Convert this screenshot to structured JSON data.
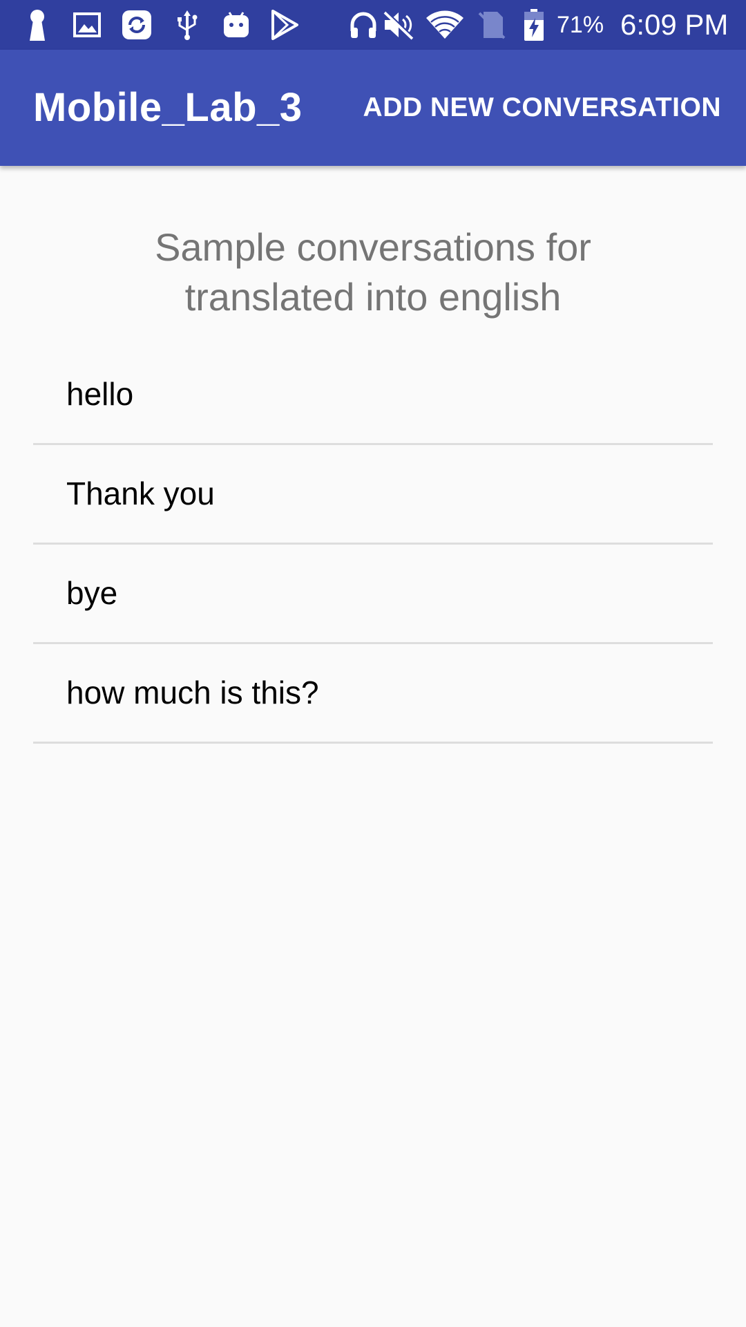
{
  "status_bar": {
    "battery_percent": "71%",
    "time": "6:09 PM",
    "icons": [
      "keyhole-icon",
      "image-icon",
      "sync-icon",
      "usb-icon",
      "android-icon",
      "play-store-icon",
      "headphones-icon",
      "mute-icon",
      "wifi-icon",
      "no-sim-icon",
      "battery-charging-icon"
    ]
  },
  "app_bar": {
    "title": "Mobile_Lab_3",
    "action_label": "ADD NEW CONVERSATION"
  },
  "main": {
    "heading_line1": "Sample conversations for",
    "heading_line2": "translated into english",
    "conversations": [
      {
        "label": "hello"
      },
      {
        "label": "Thank you"
      },
      {
        "label": "bye"
      },
      {
        "label": "how much is this?"
      }
    ]
  },
  "colors": {
    "status_bar": "#303f9f",
    "app_bar": "#3f51b5",
    "background": "#fafafa",
    "divider": "#dddddd",
    "heading_text": "#757575"
  }
}
